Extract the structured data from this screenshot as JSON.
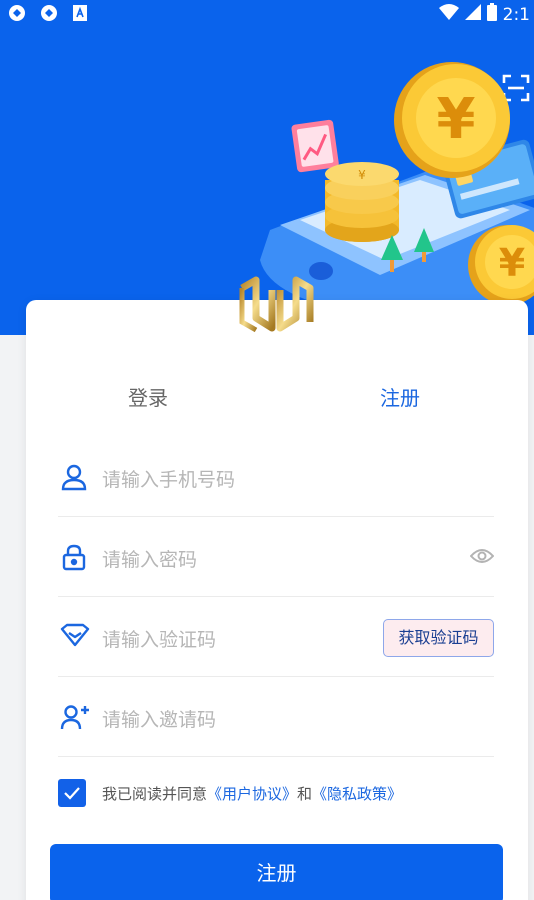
{
  "status_bar": {
    "time": "2:1"
  },
  "tabs": {
    "login": "登录",
    "register": "注册"
  },
  "fields": {
    "phone_placeholder": "请输入手机号码",
    "password_placeholder": "请输入密码",
    "code_placeholder": "请输入验证码",
    "invite_placeholder": "请输入邀请码"
  },
  "get_code_button": "获取验证码",
  "agreement": {
    "prefix": "我已阅读并同意",
    "user_agreement": "《用户协议》",
    "and": "和",
    "privacy_policy": "《隐私政策》",
    "checked": true
  },
  "submit_label": "注册",
  "colors": {
    "primary": "#0a63ec",
    "link": "#1b67e0"
  },
  "icons": [
    "user-icon",
    "lock-icon",
    "diamond-icon",
    "add-user-icon",
    "eye-icon",
    "scan-icon",
    "check-icon"
  ]
}
